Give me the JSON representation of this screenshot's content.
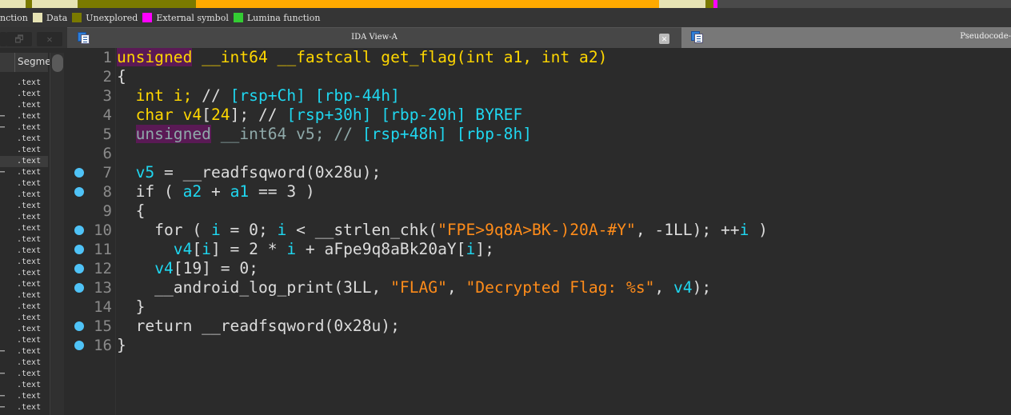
{
  "navbar": {
    "segments": [
      {
        "color": "#e6e3b4",
        "from": 0,
        "to": 2.5
      },
      {
        "color": "#7a7a00",
        "from": 2.5,
        "to": 3.2
      },
      {
        "color": "#e6e3b4",
        "from": 3.2,
        "to": 7.7
      },
      {
        "color": "#7a7a00",
        "from": 7.7,
        "to": 19.4
      },
      {
        "color": "#ffaa00",
        "from": 19.4,
        "to": 65.2
      },
      {
        "color": "#e6e3b4",
        "from": 65.2,
        "to": 69.8
      },
      {
        "color": "#7a7a00",
        "from": 69.8,
        "to": 70.6
      },
      {
        "color": "#ff00ff",
        "from": 70.6,
        "to": 71.0
      }
    ]
  },
  "legend": [
    {
      "label": "nction",
      "color": null
    },
    {
      "label": "Data",
      "color": "#e6e3b4"
    },
    {
      "label": "Unexplored",
      "color": "#7a7a00"
    },
    {
      "label": "External symbol",
      "color": "#ff00ff"
    },
    {
      "label": "Lumina function",
      "color": "#33cc33"
    }
  ],
  "window_controls": {
    "restore": "🗗",
    "close": "✕"
  },
  "segments_panel": {
    "header": "Segme",
    "rows": [
      {
        "name": ".text",
        "trunc": false
      },
      {
        "name": ".text",
        "trunc": false
      },
      {
        "name": ".text",
        "trunc": false
      },
      {
        "name": ".text",
        "trunc": true
      },
      {
        "name": ".text",
        "trunc": true
      },
      {
        "name": ".text",
        "trunc": false
      },
      {
        "name": ".text",
        "trunc": false
      },
      {
        "name": ".text",
        "trunc": false,
        "selected": true
      },
      {
        "name": ".text",
        "trunc": true
      },
      {
        "name": ".text",
        "trunc": false
      },
      {
        "name": ".text",
        "trunc": false
      },
      {
        "name": ".text",
        "trunc": false
      },
      {
        "name": ".text",
        "trunc": false
      },
      {
        "name": ".text",
        "trunc": false
      },
      {
        "name": ".text",
        "trunc": false
      },
      {
        "name": ".text",
        "trunc": false
      },
      {
        "name": ".text",
        "trunc": false
      },
      {
        "name": ".text",
        "trunc": false
      },
      {
        "name": ".text",
        "trunc": false
      },
      {
        "name": ".text",
        "trunc": false
      },
      {
        "name": ".text",
        "trunc": false
      },
      {
        "name": ".text",
        "trunc": false
      },
      {
        "name": ".text",
        "trunc": false
      },
      {
        "name": ".text",
        "trunc": false
      },
      {
        "name": ".text",
        "trunc": true
      },
      {
        "name": ".text",
        "trunc": false
      },
      {
        "name": ".text",
        "trunc": true
      },
      {
        "name": ".text",
        "trunc": false
      },
      {
        "name": ".text",
        "trunc": true
      },
      {
        "name": ".text",
        "trunc": true
      }
    ],
    "trunc_mark": "⋯"
  },
  "tabs": [
    {
      "title": "IDA View-A",
      "active": true,
      "close": "✕"
    },
    {
      "title": "Pseudocode-",
      "active": false
    }
  ],
  "code": [
    {
      "n": "1",
      "bp": false,
      "tokens": [
        [
          "tyh",
          "unsigned"
        ],
        [
          "op",
          " "
        ],
        [
          "ty",
          "__int64 __fastcall get_flag(int a1, int a2)"
        ]
      ]
    },
    {
      "n": "2",
      "bp": false,
      "tokens": [
        [
          "op",
          "{"
        ]
      ]
    },
    {
      "n": "3",
      "bp": false,
      "tokens": [
        [
          "op",
          "  "
        ],
        [
          "ty",
          "int i;"
        ],
        [
          "op",
          " // "
        ],
        [
          "va",
          "[rsp+Ch] [rbp-44h]"
        ]
      ]
    },
    {
      "n": "4",
      "bp": false,
      "tokens": [
        [
          "op",
          "  "
        ],
        [
          "ty",
          "char v4"
        ],
        [
          "op",
          "["
        ],
        [
          "ty",
          "24"
        ],
        [
          "op",
          "]; // "
        ],
        [
          "va",
          "[rsp+30h] [rbp-20h] BYREF"
        ]
      ]
    },
    {
      "n": "5",
      "bp": false,
      "tokens": [
        [
          "op",
          "  "
        ],
        [
          "tyg",
          "unsigned"
        ],
        [
          "gr",
          " __int64 v5; // "
        ],
        [
          "va",
          "[rsp+48h] [rbp-8h]"
        ]
      ]
    },
    {
      "n": "6",
      "bp": false,
      "tokens": [
        [
          "op",
          ""
        ]
      ]
    },
    {
      "n": "7",
      "bp": true,
      "tokens": [
        [
          "op",
          "  "
        ],
        [
          "va",
          "v5"
        ],
        [
          "op",
          " = __readfsqword(0x28u);"
        ]
      ]
    },
    {
      "n": "8",
      "bp": true,
      "tokens": [
        [
          "op",
          "  if ( "
        ],
        [
          "va",
          "a2"
        ],
        [
          "op",
          " + "
        ],
        [
          "va",
          "a1"
        ],
        [
          "op",
          " == 3 )"
        ]
      ]
    },
    {
      "n": "9",
      "bp": false,
      "tokens": [
        [
          "op",
          "  {"
        ]
      ]
    },
    {
      "n": "10",
      "bp": true,
      "tokens": [
        [
          "op",
          "    for ( "
        ],
        [
          "va",
          "i"
        ],
        [
          "op",
          " = 0; "
        ],
        [
          "va",
          "i"
        ],
        [
          "op",
          " < __strlen_chk("
        ],
        [
          "st",
          "\"FPE>9q8A>BK-)20A-#Y\""
        ],
        [
          "op",
          ", -1LL); ++"
        ],
        [
          "va",
          "i"
        ],
        [
          "op",
          " )"
        ]
      ]
    },
    {
      "n": "11",
      "bp": true,
      "tokens": [
        [
          "op",
          "      "
        ],
        [
          "va",
          "v4"
        ],
        [
          "op",
          "["
        ],
        [
          "va",
          "i"
        ],
        [
          "op",
          "] = 2 * "
        ],
        [
          "va",
          "i"
        ],
        [
          "op",
          " + aFpe9q8aBk20aY["
        ],
        [
          "va",
          "i"
        ],
        [
          "op",
          "];"
        ]
      ]
    },
    {
      "n": "12",
      "bp": true,
      "tokens": [
        [
          "op",
          "    "
        ],
        [
          "va",
          "v4"
        ],
        [
          "op",
          "[19] = 0;"
        ]
      ]
    },
    {
      "n": "13",
      "bp": true,
      "tokens": [
        [
          "op",
          "    __android_log_print(3LL, "
        ],
        [
          "st",
          "\"FLAG\""
        ],
        [
          "op",
          ", "
        ],
        [
          "st",
          "\"Decrypted Flag: %s\""
        ],
        [
          "op",
          ", "
        ],
        [
          "va",
          "v4"
        ],
        [
          "op",
          ");"
        ]
      ]
    },
    {
      "n": "14",
      "bp": false,
      "tokens": [
        [
          "op",
          "  }"
        ]
      ]
    },
    {
      "n": "15",
      "bp": true,
      "tokens": [
        [
          "op",
          "  return __readfsqword(0x28u);"
        ]
      ]
    },
    {
      "n": "16",
      "bp": true,
      "tokens": [
        [
          "op",
          "}"
        ]
      ]
    }
  ]
}
